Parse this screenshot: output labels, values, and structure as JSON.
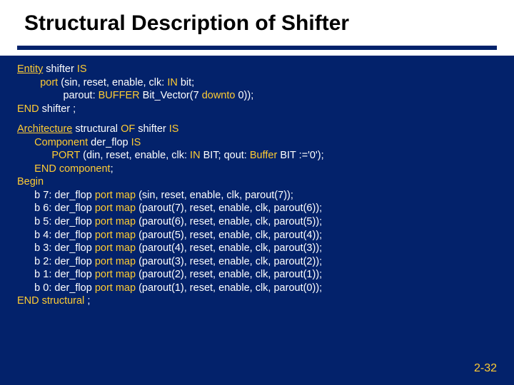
{
  "title": "Structural Description of Shifter",
  "page_number": "2-32",
  "entity": {
    "l1a": "Entity",
    "l1b": " shifter ",
    "l1c": "IS",
    "l2a": "        port",
    "l2b": " (sin, reset, enable, clk: ",
    "l2c": "IN",
    "l2d": " bit;",
    "l3a": "                parout: ",
    "l3b": "BUFFER",
    "l3c": " Bit_Vector(7 ",
    "l3d": "downto",
    "l3e": " 0));",
    "l4a": "END",
    "l4b": " shifter ;"
  },
  "arch": {
    "a1a": "Architecture",
    "a1b": " structural ",
    "a1c": "OF",
    "a1d": " shifter ",
    "a1e": "IS",
    "a2a": "      Component",
    "a2b": " der_flop ",
    "a2c": "IS",
    "a3a": "            PORT",
    "a3b": " (din, reset, enable, clk: ",
    "a3c": "IN",
    "a3d": " BIT; qout: ",
    "a3e": "Buffer",
    "a3f": " BIT :='0');",
    "a4a": "      END",
    "a4b": " component",
    "a4c": ";",
    "a5": "Begin",
    "m7a": "      b 7: der_flop ",
    "m7b": "port map",
    "m7c": " (sin, reset, enable, clk, parout(7));",
    "m6a": "      b 6: der_flop ",
    "m6b": "port map",
    "m6c": " (parout(7), reset, enable, clk, parout(6));",
    "m5a": "      b 5: der_flop ",
    "m5b": "port map",
    "m5c": " (parout(6), reset, enable, clk, parout(5));",
    "m4a": "      b 4: der_flop ",
    "m4b": "port map",
    "m4c": " (parout(5), reset, enable, clk, parout(4));",
    "m3a": "      b 3: der_flop ",
    "m3b": "port map",
    "m3c": " (parout(4), reset, enable, clk, parout(3));",
    "m2a": "      b 2: der_flop ",
    "m2b": "port map",
    "m2c": " (parout(3), reset, enable, clk, parout(2));",
    "m1a": "      b 1: der_flop ",
    "m1b": "port map",
    "m1c": " (parout(2), reset, enable, clk, parout(1));",
    "m0a": "      b 0: der_flop ",
    "m0b": "port map",
    "m0c": " (parout(1), reset, enable, clk, parout(0));",
    "e1a": "END",
    "e1b": " structural ",
    "e1c": ";"
  }
}
